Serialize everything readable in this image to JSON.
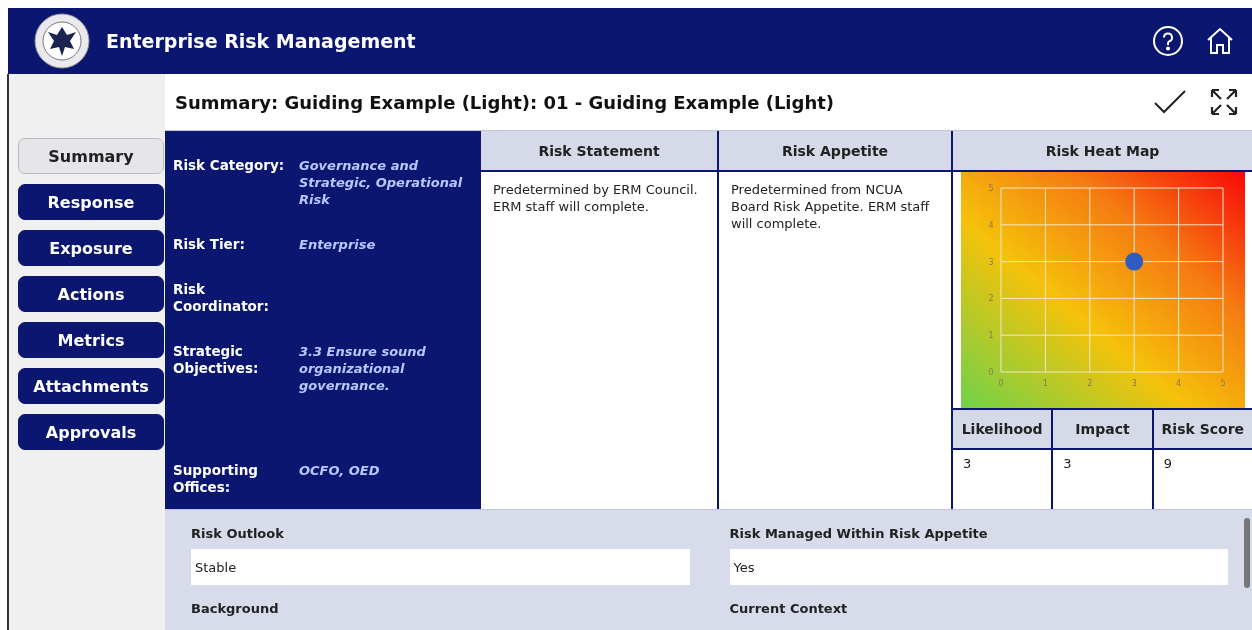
{
  "header": {
    "title": "Enterprise Risk Management"
  },
  "page_title": "Summary: Guiding Example (Light): 01 - Guiding Example (Light)",
  "nav": [
    {
      "label": "Summary",
      "selected": true
    },
    {
      "label": "Response",
      "selected": false
    },
    {
      "label": "Exposure",
      "selected": false
    },
    {
      "label": "Actions",
      "selected": false
    },
    {
      "label": "Metrics",
      "selected": false
    },
    {
      "label": "Attachments",
      "selected": false
    },
    {
      "label": "Approvals",
      "selected": false
    }
  ],
  "details": [
    {
      "label": "Risk Category:",
      "value": "Governance and Strategic, Operational Risk"
    },
    {
      "label": "Risk Tier:",
      "value": "Enterprise"
    },
    {
      "label": "Risk Coordinator:"
    },
    {
      "label": "Strategic Objectives:",
      "value": "3.3 Ensure sound organizational governance."
    },
    {
      "label": "Supporting Offices:",
      "value": "OCFO, OED"
    }
  ],
  "risk_statement": {
    "heading": "Risk Statement",
    "text": "Predetermined by ERM Council. ERM staff will complete."
  },
  "risk_appetite": {
    "heading": "Risk Appetite",
    "text": "Predetermined from NCUA Board Risk Appetite. ERM staff will complete."
  },
  "heat_map": {
    "heading": "Risk Heat Map",
    "chart_data": {
      "type": "scatter",
      "x": [
        3
      ],
      "series": [
        {
          "color": "#2f5cc0",
          "values": [
            3
          ]
        }
      ],
      "grid": true,
      "xlim": [
        0,
        5
      ],
      "ylim": [
        0,
        5
      ],
      "xticks": [
        0,
        1,
        2,
        3,
        4,
        5
      ],
      "yticks": [
        0,
        1,
        2,
        3,
        4,
        5
      ]
    }
  },
  "scores": {
    "columns": [
      "Likelihood",
      "Impact",
      "Risk Score"
    ],
    "values": [
      "3",
      "3",
      "9"
    ]
  },
  "fields": [
    {
      "label": "Risk Outlook",
      "value": "Stable"
    },
    {
      "label": "Risk Managed Within Risk Appetite",
      "value": "Yes"
    },
    {
      "label": "Background"
    },
    {
      "label": "Current Context"
    }
  ]
}
